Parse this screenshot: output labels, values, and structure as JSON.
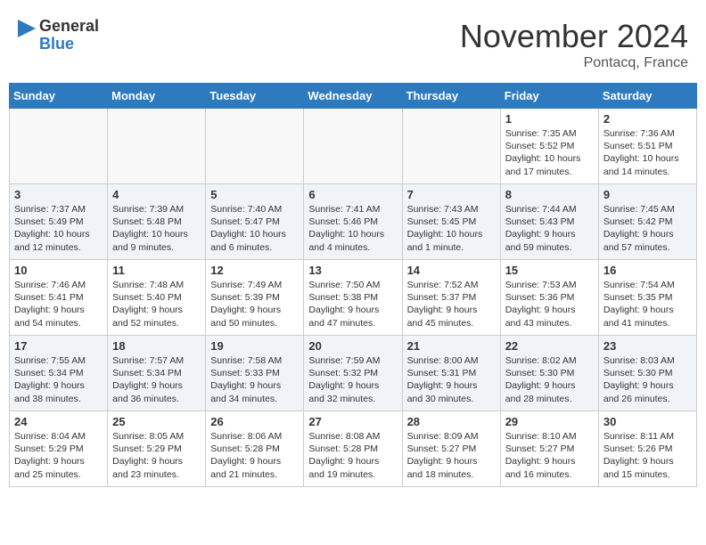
{
  "header": {
    "logo_general": "General",
    "logo_blue": "Blue",
    "month_title": "November 2024",
    "location": "Pontacq, France"
  },
  "weekdays": [
    "Sunday",
    "Monday",
    "Tuesday",
    "Wednesday",
    "Thursday",
    "Friday",
    "Saturday"
  ],
  "weeks": [
    [
      {
        "day": "",
        "info": ""
      },
      {
        "day": "",
        "info": ""
      },
      {
        "day": "",
        "info": ""
      },
      {
        "day": "",
        "info": ""
      },
      {
        "day": "",
        "info": ""
      },
      {
        "day": "1",
        "info": "Sunrise: 7:35 AM\nSunset: 5:52 PM\nDaylight: 10 hours and 17 minutes."
      },
      {
        "day": "2",
        "info": "Sunrise: 7:36 AM\nSunset: 5:51 PM\nDaylight: 10 hours and 14 minutes."
      }
    ],
    [
      {
        "day": "3",
        "info": "Sunrise: 7:37 AM\nSunset: 5:49 PM\nDaylight: 10 hours and 12 minutes."
      },
      {
        "day": "4",
        "info": "Sunrise: 7:39 AM\nSunset: 5:48 PM\nDaylight: 10 hours and 9 minutes."
      },
      {
        "day": "5",
        "info": "Sunrise: 7:40 AM\nSunset: 5:47 PM\nDaylight: 10 hours and 6 minutes."
      },
      {
        "day": "6",
        "info": "Sunrise: 7:41 AM\nSunset: 5:46 PM\nDaylight: 10 hours and 4 minutes."
      },
      {
        "day": "7",
        "info": "Sunrise: 7:43 AM\nSunset: 5:45 PM\nDaylight: 10 hours and 1 minute."
      },
      {
        "day": "8",
        "info": "Sunrise: 7:44 AM\nSunset: 5:43 PM\nDaylight: 9 hours and 59 minutes."
      },
      {
        "day": "9",
        "info": "Sunrise: 7:45 AM\nSunset: 5:42 PM\nDaylight: 9 hours and 57 minutes."
      }
    ],
    [
      {
        "day": "10",
        "info": "Sunrise: 7:46 AM\nSunset: 5:41 PM\nDaylight: 9 hours and 54 minutes."
      },
      {
        "day": "11",
        "info": "Sunrise: 7:48 AM\nSunset: 5:40 PM\nDaylight: 9 hours and 52 minutes."
      },
      {
        "day": "12",
        "info": "Sunrise: 7:49 AM\nSunset: 5:39 PM\nDaylight: 9 hours and 50 minutes."
      },
      {
        "day": "13",
        "info": "Sunrise: 7:50 AM\nSunset: 5:38 PM\nDaylight: 9 hours and 47 minutes."
      },
      {
        "day": "14",
        "info": "Sunrise: 7:52 AM\nSunset: 5:37 PM\nDaylight: 9 hours and 45 minutes."
      },
      {
        "day": "15",
        "info": "Sunrise: 7:53 AM\nSunset: 5:36 PM\nDaylight: 9 hours and 43 minutes."
      },
      {
        "day": "16",
        "info": "Sunrise: 7:54 AM\nSunset: 5:35 PM\nDaylight: 9 hours and 41 minutes."
      }
    ],
    [
      {
        "day": "17",
        "info": "Sunrise: 7:55 AM\nSunset: 5:34 PM\nDaylight: 9 hours and 38 minutes."
      },
      {
        "day": "18",
        "info": "Sunrise: 7:57 AM\nSunset: 5:34 PM\nDaylight: 9 hours and 36 minutes."
      },
      {
        "day": "19",
        "info": "Sunrise: 7:58 AM\nSunset: 5:33 PM\nDaylight: 9 hours and 34 minutes."
      },
      {
        "day": "20",
        "info": "Sunrise: 7:59 AM\nSunset: 5:32 PM\nDaylight: 9 hours and 32 minutes."
      },
      {
        "day": "21",
        "info": "Sunrise: 8:00 AM\nSunset: 5:31 PM\nDaylight: 9 hours and 30 minutes."
      },
      {
        "day": "22",
        "info": "Sunrise: 8:02 AM\nSunset: 5:30 PM\nDaylight: 9 hours and 28 minutes."
      },
      {
        "day": "23",
        "info": "Sunrise: 8:03 AM\nSunset: 5:30 PM\nDaylight: 9 hours and 26 minutes."
      }
    ],
    [
      {
        "day": "24",
        "info": "Sunrise: 8:04 AM\nSunset: 5:29 PM\nDaylight: 9 hours and 25 minutes."
      },
      {
        "day": "25",
        "info": "Sunrise: 8:05 AM\nSunset: 5:29 PM\nDaylight: 9 hours and 23 minutes."
      },
      {
        "day": "26",
        "info": "Sunrise: 8:06 AM\nSunset: 5:28 PM\nDaylight: 9 hours and 21 minutes."
      },
      {
        "day": "27",
        "info": "Sunrise: 8:08 AM\nSunset: 5:28 PM\nDaylight: 9 hours and 19 minutes."
      },
      {
        "day": "28",
        "info": "Sunrise: 8:09 AM\nSunset: 5:27 PM\nDaylight: 9 hours and 18 minutes."
      },
      {
        "day": "29",
        "info": "Sunrise: 8:10 AM\nSunset: 5:27 PM\nDaylight: 9 hours and 16 minutes."
      },
      {
        "day": "30",
        "info": "Sunrise: 8:11 AM\nSunset: 5:26 PM\nDaylight: 9 hours and 15 minutes."
      }
    ]
  ]
}
